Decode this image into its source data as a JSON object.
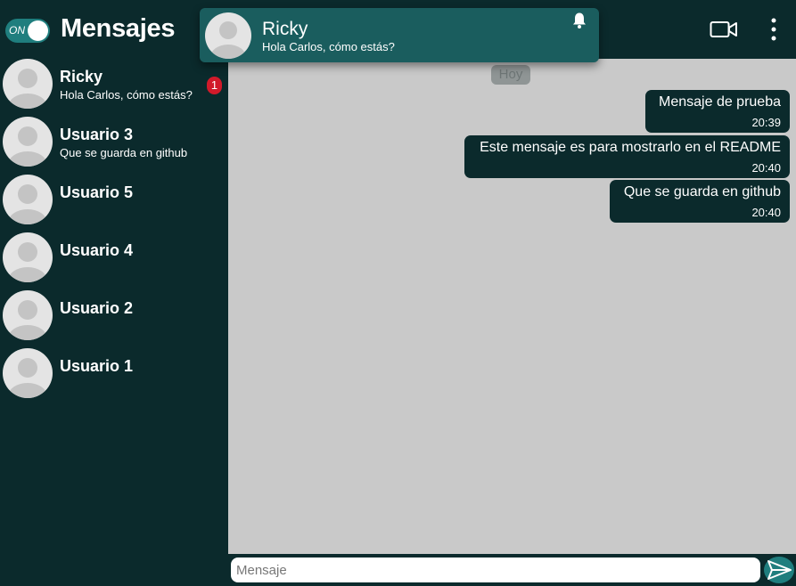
{
  "sidebar": {
    "toggle_label": "ON",
    "title": "Mensajes",
    "contacts": [
      {
        "name": "Ricky",
        "preview": "Hola Carlos, cómo estás?",
        "unread": "1"
      },
      {
        "name": "Usuario 3",
        "preview": "Que se guarda en github",
        "unread": ""
      },
      {
        "name": "Usuario 5",
        "preview": "",
        "unread": ""
      },
      {
        "name": "Usuario 4",
        "preview": "",
        "unread": ""
      },
      {
        "name": "Usuario 2",
        "preview": "",
        "unread": ""
      },
      {
        "name": "Usuario 1",
        "preview": "",
        "unread": ""
      }
    ]
  },
  "chat": {
    "date_label": "Hoy",
    "messages": [
      {
        "text": "Mensaje de prueba",
        "time": "20:39"
      },
      {
        "text": "Este mensaje es para mostrarlo en el README",
        "time": "20:40"
      },
      {
        "text": "Que se guarda en github",
        "time": "20:40"
      }
    ],
    "input_placeholder": "Mensaje",
    "input_value": ""
  },
  "notification": {
    "title": "Ricky",
    "body": "Hola Carlos, cómo estás?"
  },
  "icons": {
    "video": "video-camera-icon",
    "menu": "more-vertical-icon",
    "send": "send-icon",
    "bell": "bell-icon",
    "avatar": "user-avatar-icon"
  },
  "colors": {
    "dark_teal": "#0b2a2c",
    "accent_teal": "#1f7e7e",
    "notification_bg": "#1a5d5e",
    "chat_bg": "#c9c9c9",
    "badge_red": "#d11a2a"
  }
}
